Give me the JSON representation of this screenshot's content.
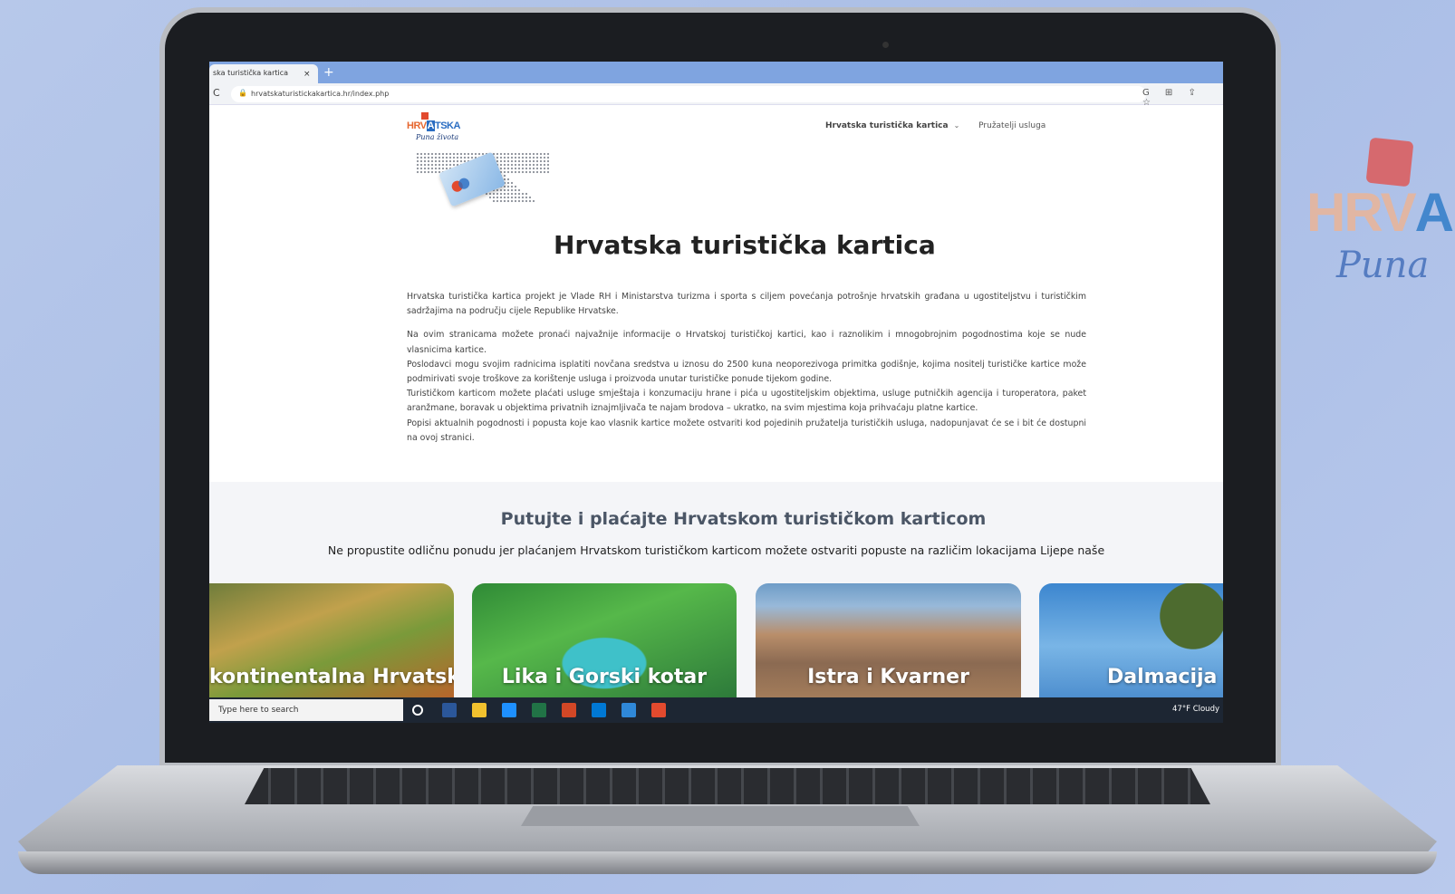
{
  "background_logo": {
    "word_a": "HRV",
    "word_b": "A",
    "script": "Puna"
  },
  "browser": {
    "tab_title": "ska turistička kartica",
    "tab_close": "×",
    "new_tab": "+",
    "reload_icon": "C",
    "url": "hrvatskaturistickakartica.hr/index.php",
    "toolbar_icons": "G ⊞ ⇪ ☆"
  },
  "site": {
    "logo_word_a": "HRV",
    "logo_word_b": "A",
    "logo_word_c": "TSKA",
    "logo_script": "Puna života",
    "nav": [
      {
        "label": "Hrvatska turistička kartica",
        "chevron": "⌄"
      },
      {
        "label": "Pružatelji usluga"
      }
    ],
    "title": "Hrvatska turistička kartica",
    "paragraphs": [
      "Hrvatska turistička kartica projekt je Vlade RH i Ministarstva turizma i sporta s ciljem povećanja potrošnje hrvatskih građana u ugostiteljstvu i turističkim sadržajima na području cijele Republike Hrvatske.",
      "Na ovim stranicama možete pronaći najvažnije informacije o Hrvatskoj turističkoj kartici, kao i raznolikim i mnogobrojnim pogodnostima koje se nude vlasnicima kartice.",
      "Poslodavci mogu svojim radnicima isplatiti novčana sredstva u iznosu do 2500 kuna neoporezivoga primitka godišnje, kojima nositelj turističke kartice može podmirivati svoje troškove za korištenje usluga i proizvoda unutar turističke ponude tijekom godine.",
      "Turističkom karticom možete plaćati usluge smještaja i konzumaciju hrane i pića u ugostiteljskim objektima, usluge putničkih agencija i turoperatora, paket aranžmane, boravak u objektima privatnih iznajmljivača te najam brodova – ukratko, na svim mjestima koja prihvaćaju platne kartice.",
      "Popisi aktualnih pogodnosti i popusta koje kao vlasnik kartice možete ostvariti kod pojedinih pružatelja turističkih usluga, nadopunjavat će se i bit će dostupni na ovoj stranici."
    ],
    "band_title": "Putujte i plaćajte Hrvatskom turističkom karticom",
    "band_subtitle": "Ne propustite odličnu ponudu jer plaćanjem Hrvatskom turističkom karticom možete ostvariti popuste na različim lokacijama Lijepe naše",
    "regions": [
      "kontinentalna Hrvatska",
      "Lika i Gorski kotar",
      "Istra i Kvarner",
      "Dalmacija"
    ]
  },
  "taskbar": {
    "search_placeholder": "Type here to search",
    "weather": "47°F Cloudy",
    "app_colors": [
      "#ffffff",
      "#2b579a",
      "#f2c12e",
      "#1e90ff",
      "#217346",
      "#d24726",
      "#0078d4",
      "#2f88d8",
      "#e24a2e"
    ]
  }
}
